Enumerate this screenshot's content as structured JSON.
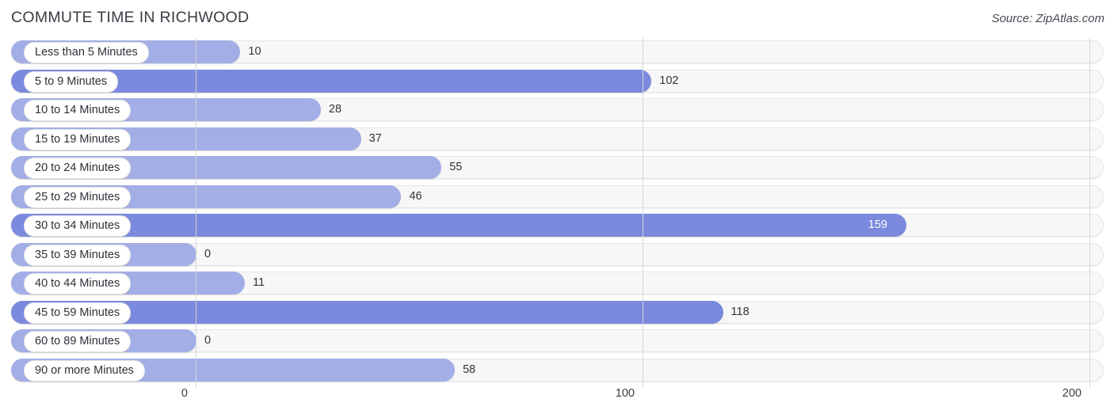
{
  "header": {
    "title": "COMMUTE TIME IN RICHWOOD",
    "source": "Source: ZipAtlas.com"
  },
  "colors": {
    "bar_light": "#a3aee6",
    "bar_dark": "#7b8ade",
    "track": "#f7f7f7",
    "track_border": "#e6e6e6",
    "gridline": "#d6d6d6",
    "text": "#33333c",
    "title": "#3c3c46"
  },
  "chart_data": {
    "type": "bar",
    "orientation": "horizontal",
    "title": "COMMUTE TIME IN RICHWOOD",
    "xlabel": "",
    "ylabel": "",
    "xlim": [
      0,
      200
    ],
    "xticks": [
      0,
      100,
      200
    ],
    "xtick_labels": [
      "0",
      "100",
      "200"
    ],
    "grid": true,
    "legend": false,
    "categories": [
      "Less than 5 Minutes",
      "5 to 9 Minutes",
      "10 to 14 Minutes",
      "15 to 19 Minutes",
      "20 to 24 Minutes",
      "25 to 29 Minutes",
      "30 to 34 Minutes",
      "35 to 39 Minutes",
      "40 to 44 Minutes",
      "45 to 59 Minutes",
      "60 to 89 Minutes",
      "90 or more Minutes"
    ],
    "values": [
      10,
      102,
      28,
      37,
      55,
      46,
      159,
      0,
      11,
      118,
      0,
      58
    ],
    "value_labels": [
      "10",
      "102",
      "28",
      "37",
      "55",
      "46",
      "159",
      "0",
      "11",
      "118",
      "0",
      "58"
    ]
  },
  "rows": [
    {
      "label": "Less than 5 Minutes",
      "value": "10",
      "num": 10,
      "dark": false,
      "inside": false
    },
    {
      "label": "5 to 9 Minutes",
      "value": "102",
      "num": 102,
      "dark": true,
      "inside": false
    },
    {
      "label": "10 to 14 Minutes",
      "value": "28",
      "num": 28,
      "dark": false,
      "inside": false
    },
    {
      "label": "15 to 19 Minutes",
      "value": "37",
      "num": 37,
      "dark": false,
      "inside": false
    },
    {
      "label": "20 to 24 Minutes",
      "value": "55",
      "num": 55,
      "dark": false,
      "inside": false
    },
    {
      "label": "25 to 29 Minutes",
      "value": "46",
      "num": 46,
      "dark": false,
      "inside": false
    },
    {
      "label": "30 to 34 Minutes",
      "value": "159",
      "num": 159,
      "dark": true,
      "inside": true
    },
    {
      "label": "35 to 39 Minutes",
      "value": "0",
      "num": 0,
      "dark": false,
      "inside": false
    },
    {
      "label": "40 to 44 Minutes",
      "value": "11",
      "num": 11,
      "dark": false,
      "inside": false
    },
    {
      "label": "45 to 59 Minutes",
      "value": "118",
      "num": 118,
      "dark": true,
      "inside": false
    },
    {
      "label": "60 to 89 Minutes",
      "value": "0",
      "num": 0,
      "dark": false,
      "inside": false
    },
    {
      "label": "90 or more Minutes",
      "value": "58",
      "num": 58,
      "dark": false,
      "inside": false
    }
  ],
  "axis": {
    "ticks": [
      {
        "label": "0",
        "num": 0
      },
      {
        "label": "100",
        "num": 100
      },
      {
        "label": "200",
        "num": 200
      }
    ]
  }
}
